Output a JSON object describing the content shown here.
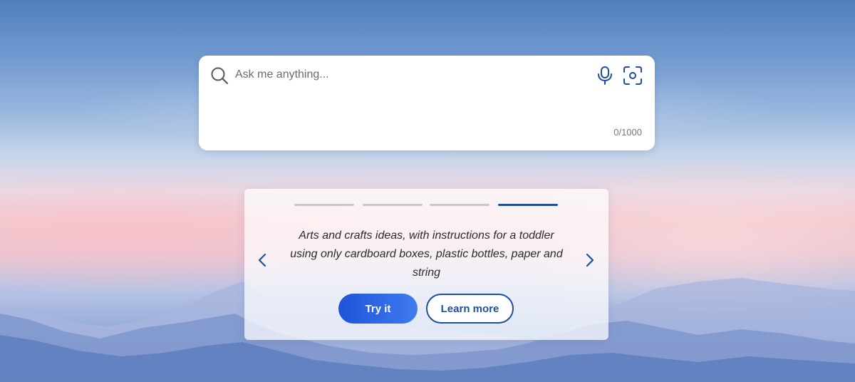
{
  "search": {
    "placeholder": "Ask me anything...",
    "value": "",
    "char_counter": "0/1000",
    "icons": {
      "search": "search-icon",
      "mic": "microphone-icon",
      "visual_search": "visual-search-icon"
    }
  },
  "suggestions": {
    "total": 4,
    "active_index": 3,
    "text": "Arts and crafts ideas, with instructions for a toddler using only cardboard boxes, plastic bottles, paper and string",
    "try_label": "Try it",
    "learn_label": "Learn more",
    "icons": {
      "prev": "chevron-left-icon",
      "next": "chevron-right-icon"
    }
  },
  "colors": {
    "accent": "#1f4e9f",
    "button_gradient_start": "#1e54d9",
    "button_gradient_end": "#3f7bf0"
  }
}
